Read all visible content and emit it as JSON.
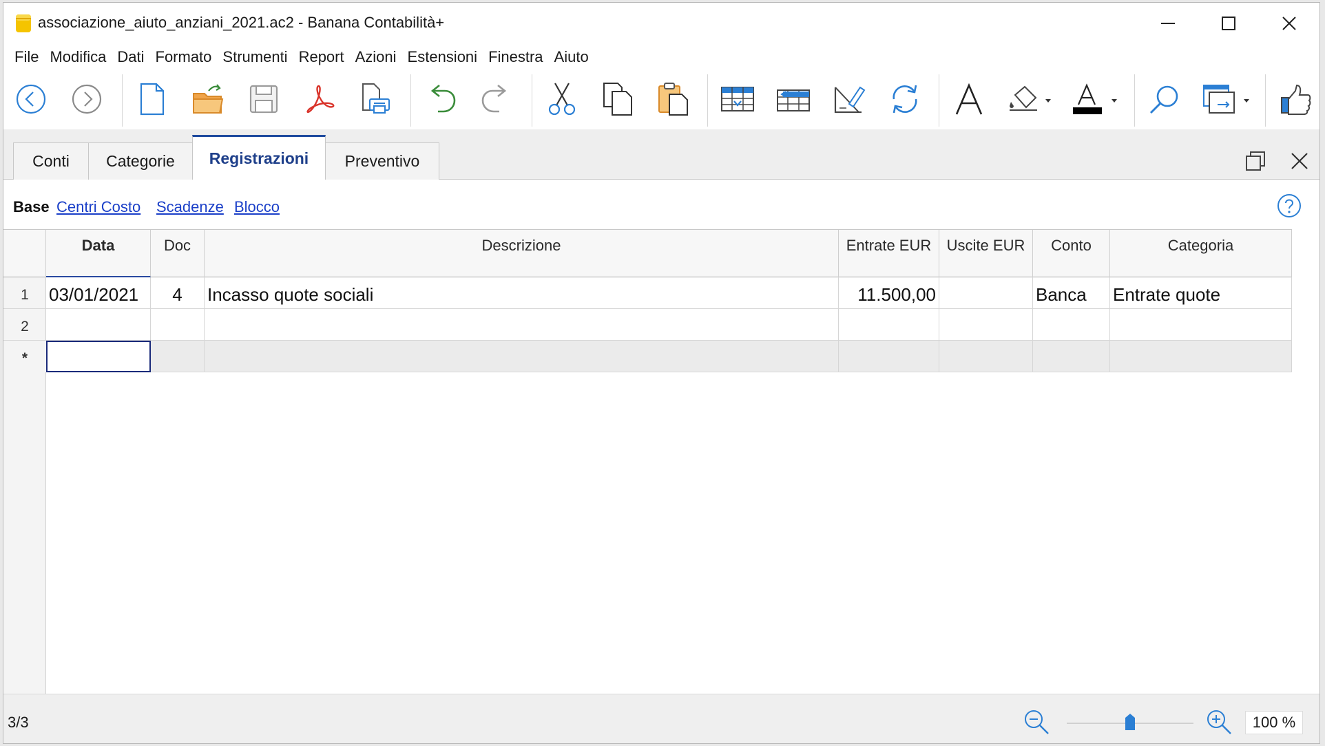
{
  "window": {
    "title": "associazione_aiuto_anziani_2021.ac2 - Banana Contabilità+",
    "controls": {
      "minimize_icon": "minimize-icon",
      "maximize_icon": "maximize-icon",
      "close_icon": "close-icon"
    }
  },
  "menu": [
    "File",
    "Modifica",
    "Dati",
    "Formato",
    "Strumenti",
    "Report",
    "Azioni",
    "Estensioni",
    "Finestra",
    "Aiuto"
  ],
  "toolbar": [
    "back-icon",
    "forward-icon",
    "new-file-icon",
    "open-file-icon",
    "save-icon",
    "pdf-icon",
    "print-icon",
    "undo-icon",
    "redo-icon",
    "cut-icon",
    "copy-icon",
    "paste-icon",
    "insert-row-icon",
    "add-row-icon",
    "edit-icon",
    "refresh-icon",
    "font-icon",
    "fill-color-icon",
    "text-color-icon",
    "search-icon",
    "window-icon",
    "thumbs-up-icon"
  ],
  "tabs": [
    {
      "label": "Conti",
      "active": false
    },
    {
      "label": "Categorie",
      "active": false
    },
    {
      "label": "Registrazioni",
      "active": true
    },
    {
      "label": "Preventivo",
      "active": false
    }
  ],
  "views": [
    {
      "label": "Base",
      "active": true
    },
    {
      "label": "Centri Costo",
      "active": false
    },
    {
      "label": "Scadenze",
      "active": false
    },
    {
      "label": "Blocco",
      "active": false
    }
  ],
  "table": {
    "columns": [
      "Data",
      "Doc",
      "Descrizione",
      "Entrate EUR",
      "Uscite EUR",
      "Conto",
      "Categoria"
    ],
    "selected_column": "Data",
    "rows": [
      {
        "num": "1",
        "cells": [
          "03/01/2021",
          "4",
          "Incasso quote sociali",
          "11.500,00",
          "",
          "Banca",
          "Entrate quote"
        ]
      },
      {
        "num": "2",
        "cells": [
          "",
          "",
          "",
          "",
          "",
          "",
          ""
        ]
      },
      {
        "num": "*",
        "cells": [
          "",
          "",
          "",
          "",
          "",
          "",
          ""
        ]
      }
    ]
  },
  "status": {
    "position": "3/3",
    "zoom": "100 %",
    "zoom_level": 0.5
  },
  "colors": {
    "accent": "#1e4a9e",
    "link": "#1a3fc8",
    "pdf_red": "#d9342b",
    "undo_green": "#3a8c3a",
    "icon_blue": "#2b7fd4"
  }
}
